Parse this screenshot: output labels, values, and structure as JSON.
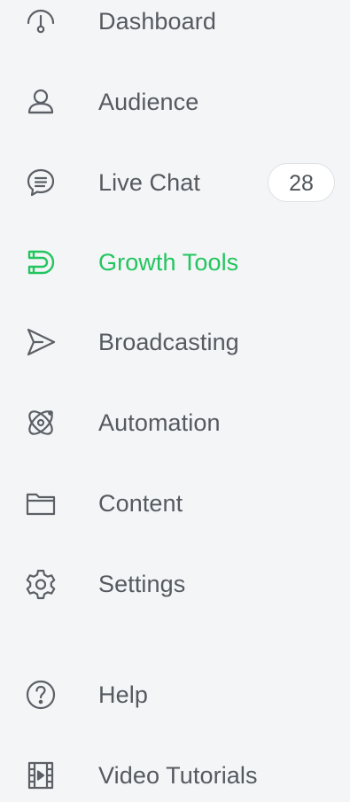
{
  "colors": {
    "text": "#555a60",
    "icon": "#5b6066",
    "active": "#23c55e",
    "background": "#f4f5f7",
    "badge_background": "#ffffff",
    "badge_border": "#dfe1e5"
  },
  "nav": {
    "items": [
      {
        "label": "Dashboard",
        "icon": "dashboard-gauge-icon",
        "active": false
      },
      {
        "label": "Audience",
        "icon": "person-icon",
        "active": false
      },
      {
        "label": "Live Chat",
        "icon": "chat-bubble-icon",
        "active": false,
        "badge": "28"
      },
      {
        "label": "Growth Tools",
        "icon": "magnet-icon",
        "active": true
      },
      {
        "label": "Broadcasting",
        "icon": "send-arrow-icon",
        "active": false
      },
      {
        "label": "Automation",
        "icon": "atom-icon",
        "active": false
      },
      {
        "label": "Content",
        "icon": "folder-icon",
        "active": false
      },
      {
        "label": "Settings",
        "icon": "gear-icon",
        "active": false
      }
    ],
    "secondary": [
      {
        "label": "Help",
        "icon": "question-circle-icon",
        "active": false
      },
      {
        "label": "Video Tutorials",
        "icon": "film-icon",
        "active": false
      }
    ]
  }
}
